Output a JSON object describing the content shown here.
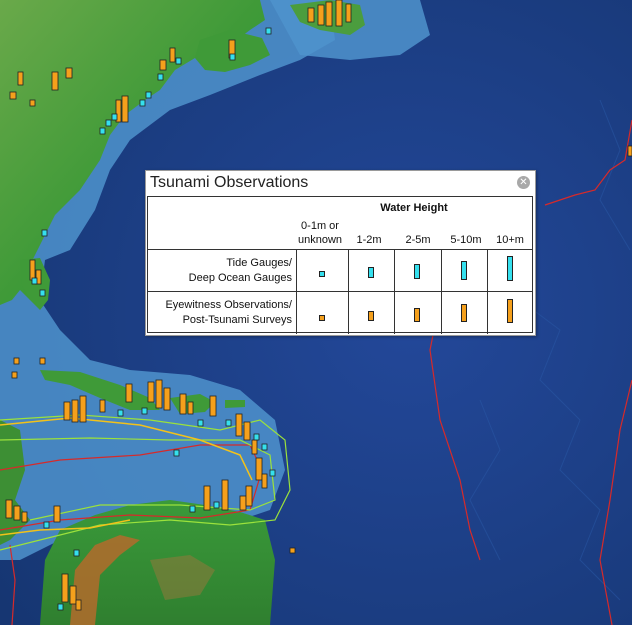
{
  "colors": {
    "ocean_deep": "#1c3f8f",
    "ocean_shelf": "#5fa6d6",
    "land_low": "#3e9b3a",
    "land_high": "#b36b2c",
    "tide_gauge": "#35e0ee",
    "eyewitness": "#f5a01c",
    "plate_boundary": "#d62a2a",
    "hazard_zone": "#9be23c"
  },
  "legend": {
    "title": "Tsunami Observations",
    "close_icon": "close-icon",
    "water_height_label": "Water Height",
    "columns": [
      "0-1m or unknown",
      "1-2m",
      "2-5m",
      "5-10m",
      "10+m"
    ],
    "column_line1": [
      "0-1m or",
      "1-2m",
      "2-5m",
      "5-10m",
      "10+m"
    ],
    "column_line2": [
      "unknown",
      "",
      "",
      "",
      ""
    ],
    "rows": [
      {
        "line1": "Tide Gauges/",
        "line2": "Deep Ocean Gauges",
        "symbol_color": "#35e0ee"
      },
      {
        "line1": "Eyewitness Observations/",
        "line2": "Post-Tsunami Surveys",
        "symbol_color": "#f5a01c"
      }
    ]
  }
}
